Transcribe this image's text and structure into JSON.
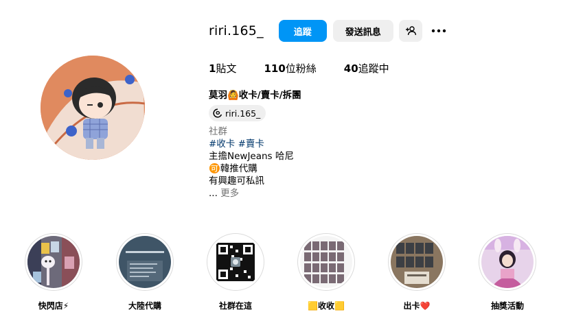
{
  "profile": {
    "username": "riri.165_",
    "follow_label": "追蹤",
    "message_label": "發送訊息",
    "stats": {
      "posts_count": "1",
      "posts_label": "貼文",
      "followers_count": "110",
      "followers_label": "位粉絲",
      "following_count": "40",
      "following_label": "追蹤中"
    },
    "full_name": "莫羽🙆收卡/賣卡/拆團",
    "threads_handle": "riri.165_",
    "bio": {
      "category": "社群",
      "tag1": "#收卡",
      "tag2": "#賣卡",
      "line1": "主擔NewJeans 哈尼",
      "line2": "🉑韓推代購",
      "line3": "有興趣可私訊",
      "ellipsis": "...",
      "more": "更多"
    }
  },
  "highlights": [
    {
      "label": "快閃店⚡"
    },
    {
      "label": "大陸代購"
    },
    {
      "label": "社群在這"
    },
    {
      "label": "🟨收收🟨"
    },
    {
      "label": "出卡❤️"
    },
    {
      "label": "抽獎活動"
    }
  ],
  "colors": {
    "primary_button": "#0095f6",
    "secondary_button": "#efefef",
    "link": "#00376b",
    "muted": "#737373"
  }
}
